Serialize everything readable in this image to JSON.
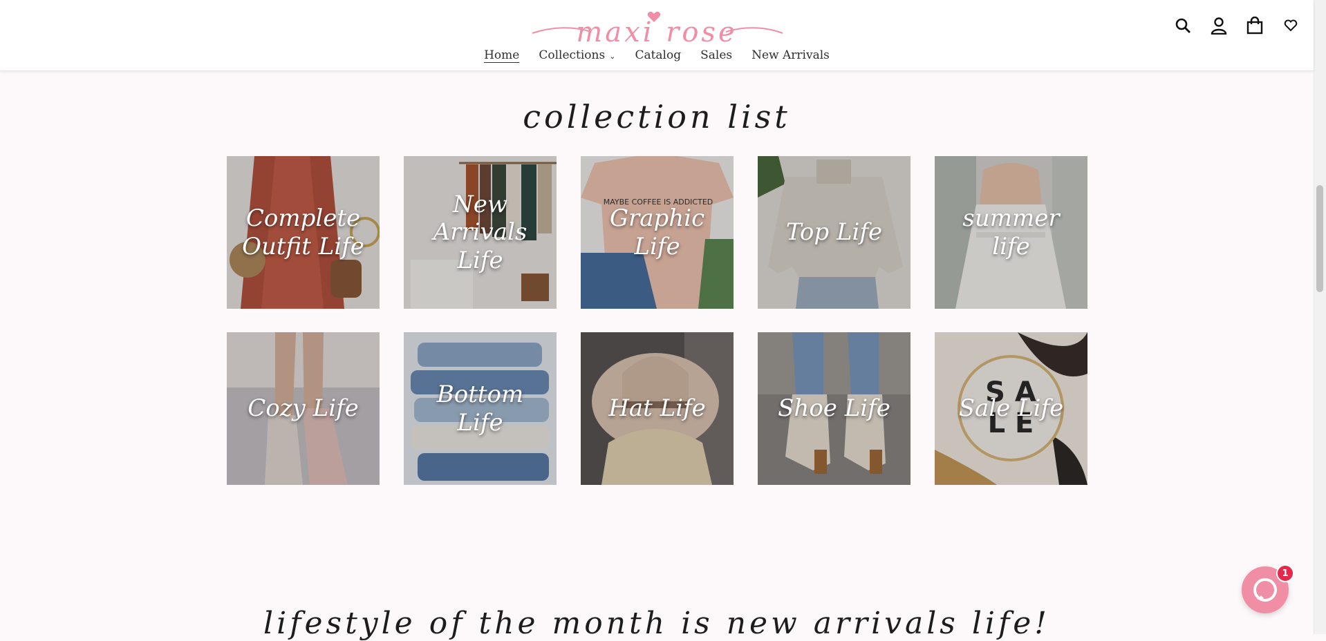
{
  "brand": {
    "logo_text": "maxi rose",
    "color": "#f08ea6"
  },
  "nav": {
    "items": [
      {
        "label": "Home",
        "active": true
      },
      {
        "label": "Collections",
        "has_dropdown": true
      },
      {
        "label": "Catalog"
      },
      {
        "label": "Sales"
      },
      {
        "label": "New Arrivals"
      }
    ]
  },
  "header_icons": [
    "search-icon",
    "account-icon",
    "cart-icon",
    "wishlist-icon"
  ],
  "collection_list": {
    "title": "collection list",
    "tiles": [
      {
        "label": "Complete Outfit Life"
      },
      {
        "label": "New Arrivals Life"
      },
      {
        "label": "Graphic Life"
      },
      {
        "label": "Top Life"
      },
      {
        "label": "summer life"
      },
      {
        "label": "Cozy Life"
      },
      {
        "label": "Bottom Life"
      },
      {
        "label": "Hat Life"
      },
      {
        "label": "Shoe Life"
      },
      {
        "label": "Sale Life"
      }
    ]
  },
  "tile_art": {
    "sale_text_top": "S A",
    "sale_text_bottom": "L E",
    "graphic_tee_text": "MAYBE COFFEE IS ADDICTED"
  },
  "lifestyle": {
    "title": "lifestyle of the month is new arrivals life!"
  },
  "chat": {
    "badge_count": "1"
  }
}
